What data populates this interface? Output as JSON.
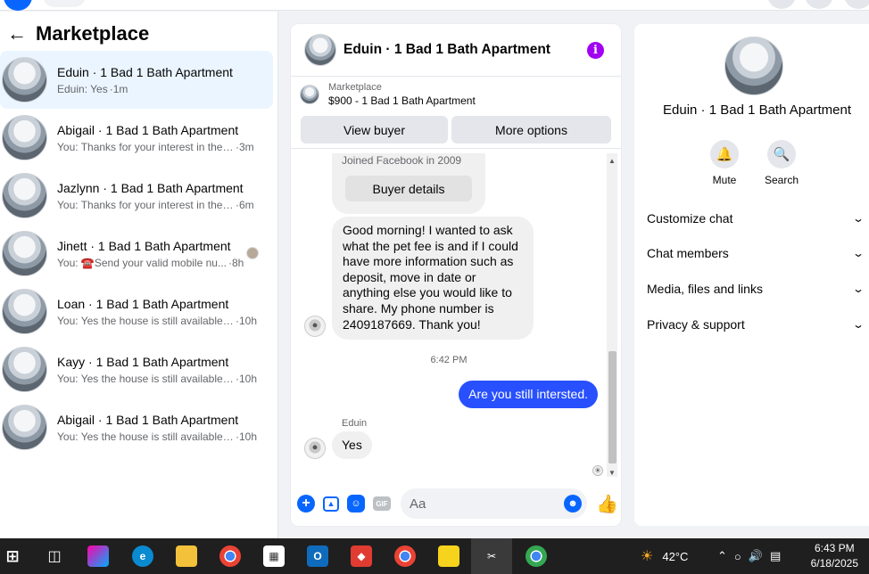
{
  "sidebar": {
    "title": "Marketplace",
    "conversations": [
      {
        "title": "Eduin · 1 Bad 1 Bath Apartment",
        "snippet": "Eduin: Yes",
        "time": "·1m",
        "active": true
      },
      {
        "title": "Abigail · 1 Bad 1 Bath Apartment",
        "snippet": "You: Thanks for your interest in the h...",
        "time": "·3m"
      },
      {
        "title": "Jazlynn · 1 Bad 1 Bath Apartment",
        "snippet": "You: Thanks for your interest in the h...",
        "time": "·6m"
      },
      {
        "title": "Jinett · 1 Bad 1 Bath Apartment",
        "snippet": "You: ☎️Send your valid mobile nu...",
        "time": "·8h"
      },
      {
        "title": "Loan · 1 Bad 1 Bath Apartment",
        "snippet": "You: Yes the house is still available fo...",
        "time": "·10h"
      },
      {
        "title": "Kayy · 1 Bad 1 Bath Apartment",
        "snippet": "You: Yes the house is still available fo...",
        "time": "·10h"
      },
      {
        "title": "Abigail · 1 Bad 1 Bath Apartment",
        "snippet": "You: Yes the house is still available fo...",
        "time": "·10h"
      }
    ]
  },
  "chat": {
    "title": "Eduin · 1 Bad 1 Bath Apartment",
    "listing_source": "Marketplace",
    "listing_price": "$900 - 1 Bad 1 Bath Apartment",
    "view_buyer": "View buyer",
    "more_options": "More options",
    "joined": "Joined Facebook in 2009",
    "buyer_details": "Buyer details",
    "incoming_message": "Good morning! I wanted to ask what the pet fee is and if I could have more information such as deposit, move in date or anything else you would like to share. My phone number is 2409187669. Thank you!",
    "timestamp": "6:42 PM",
    "outgoing_message": "Are you still intersted.",
    "sender_name": "Eduin",
    "reply": "Yes",
    "input_placeholder": "Aa"
  },
  "details": {
    "name": "Eduin · 1 Bad 1 Bath Apartment",
    "mute": "Mute",
    "search": "Search",
    "menu": [
      "Customize chat",
      "Chat members",
      "Media, files and links",
      "Privacy & support"
    ]
  },
  "taskbar": {
    "weather": "42°C",
    "time": "6:43 PM",
    "date": "6/18/2025"
  },
  "colors": {
    "accent": "#0866ff",
    "outgoing_bubble": "#2850ff",
    "info": "#a100f2"
  }
}
